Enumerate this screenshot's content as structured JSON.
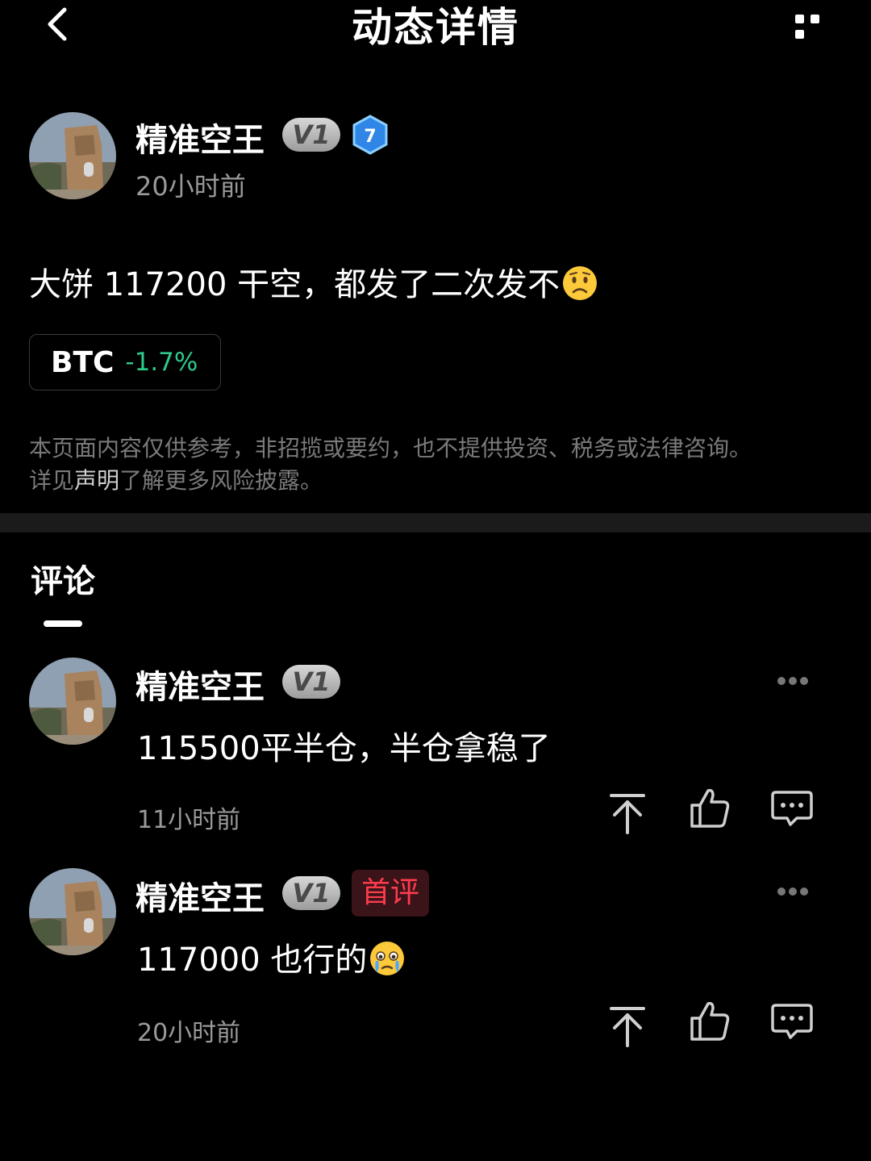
{
  "header": {
    "title": "动态详情",
    "back_icon": "chevron-left-icon",
    "more_icon": "more-horizontal-icon"
  },
  "post": {
    "author": "精准空王",
    "vip_badge": "V1",
    "level": "7",
    "time": "20小时前",
    "text": "大饼 117200 干空，都发了二次发不",
    "text_emoji": "worried-face-emoji",
    "ticker": {
      "symbol": "BTC",
      "change": "-1.7%",
      "change_color": "#2ec98b"
    }
  },
  "disclaimer": {
    "line1": "本页面内容仅供参考，非招揽或要约，也不提供投资、税务或法律咨询。",
    "line2_pre": "详见",
    "line2_link": "声明",
    "line2_post": "了解更多风险披露。"
  },
  "comments_section": {
    "tab_label": "评论"
  },
  "comments": [
    {
      "author": "精准空王",
      "vip_badge": "V1",
      "text": "115500平半仓，半仓拿稳了",
      "time": "11小时前"
    },
    {
      "author": "精准空王",
      "vip_badge": "V1",
      "first_badge": "首评",
      "text": "117000 也行的",
      "text_emoji": "crying-face-emoji",
      "time": "20小时前"
    }
  ],
  "colors": {
    "background": "#000000",
    "accent_green": "#2ec98b",
    "accent_red": "#ff3b4e"
  }
}
